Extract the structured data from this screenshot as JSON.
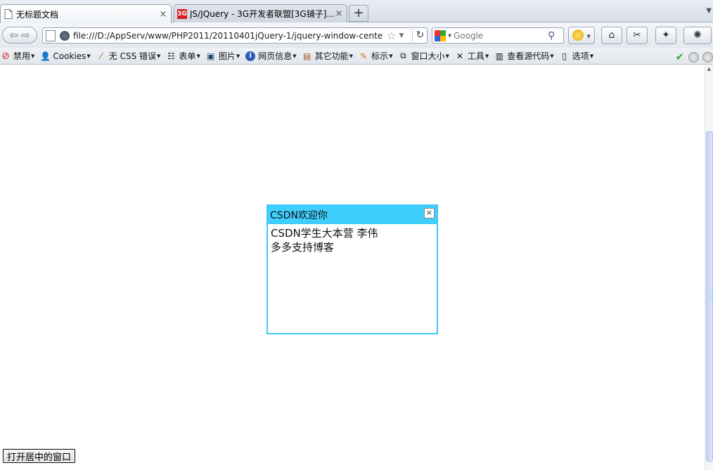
{
  "tabs": [
    {
      "title": "无标题文档",
      "favicon": "page-icon",
      "active": true
    },
    {
      "title": "JS/JQuery - 3G开发者联盟[3G铺子]...",
      "favicon": "3g-logo-icon",
      "favicon_text": "3G",
      "active": false
    }
  ],
  "tab_close_glyph": "×",
  "new_tab_glyph": "+",
  "navbar": {
    "url": "file:///D:/AppServ/www/PHP2011/20110401jQuery-1/jquery-window-center.html",
    "search_placeholder": "Google",
    "back_glyph": "⇦",
    "forward_glyph": "⇨"
  },
  "devbar": {
    "items": [
      {
        "label": "禁用",
        "icon": "disable-icon"
      },
      {
        "label": "Cookies",
        "icon": "person-icon"
      },
      {
        "label": "无 CSS 错误",
        "icon": "wand-icon"
      },
      {
        "label": "表单",
        "icon": "form-icon"
      },
      {
        "label": "图片",
        "icon": "image-icon"
      },
      {
        "label": "网页信息",
        "icon": "info-icon"
      },
      {
        "label": "其它功能",
        "icon": "misc-icon"
      },
      {
        "label": "标示",
        "icon": "pencil-icon"
      },
      {
        "label": "窗口大小",
        "icon": "resize-icon"
      },
      {
        "label": "工具",
        "icon": "tools-icon"
      },
      {
        "label": "查看源代码",
        "icon": "source-icon"
      },
      {
        "label": "选项",
        "icon": "options-icon"
      }
    ]
  },
  "dialog": {
    "title": "CSDN欢迎你",
    "close_glyph": "×",
    "body_line1": "CSDN学生大本营 李伟",
    "body_line2": "多多支持博客"
  },
  "open_button_label": "打开居中的窗口",
  "colors": {
    "dialog_header": "#3fcfff",
    "dialog_border": "#3ec8f5"
  }
}
